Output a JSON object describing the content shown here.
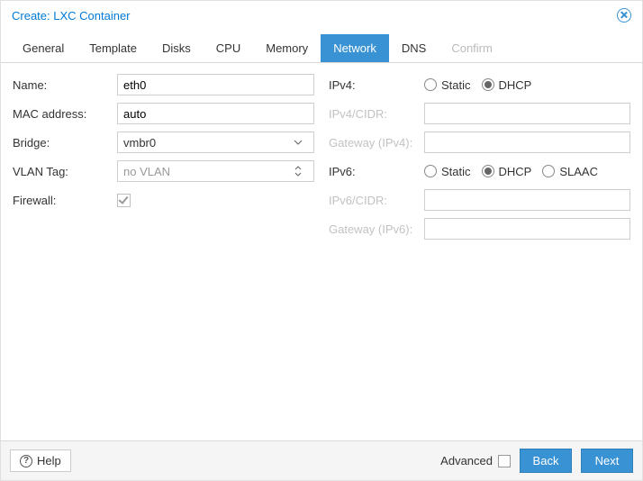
{
  "title": "Create: LXC Container",
  "tabs": [
    "General",
    "Template",
    "Disks",
    "CPU",
    "Memory",
    "Network",
    "DNS",
    "Confirm"
  ],
  "active_tab": "Network",
  "disabled_tab": "Confirm",
  "left": {
    "name_label": "Name:",
    "name_value": "eth0",
    "mac_label": "MAC address:",
    "mac_value": "auto",
    "bridge_label": "Bridge:",
    "bridge_value": "vmbr0",
    "vlan_label": "VLAN Tag:",
    "vlan_value": "no VLAN",
    "firewall_label": "Firewall:"
  },
  "right": {
    "ipv4_label": "IPv4:",
    "ipv4_static": "Static",
    "ipv4_dhcp": "DHCP",
    "ipv4cidr_label": "IPv4/CIDR:",
    "gw4_label": "Gateway (IPv4):",
    "ipv6_label": "IPv6:",
    "ipv6_static": "Static",
    "ipv6_dhcp": "DHCP",
    "ipv6_slaac": "SLAAC",
    "ipv6cidr_label": "IPv6/CIDR:",
    "gw6_label": "Gateway (IPv6):"
  },
  "footer": {
    "help": "Help",
    "advanced": "Advanced",
    "back": "Back",
    "next": "Next"
  }
}
